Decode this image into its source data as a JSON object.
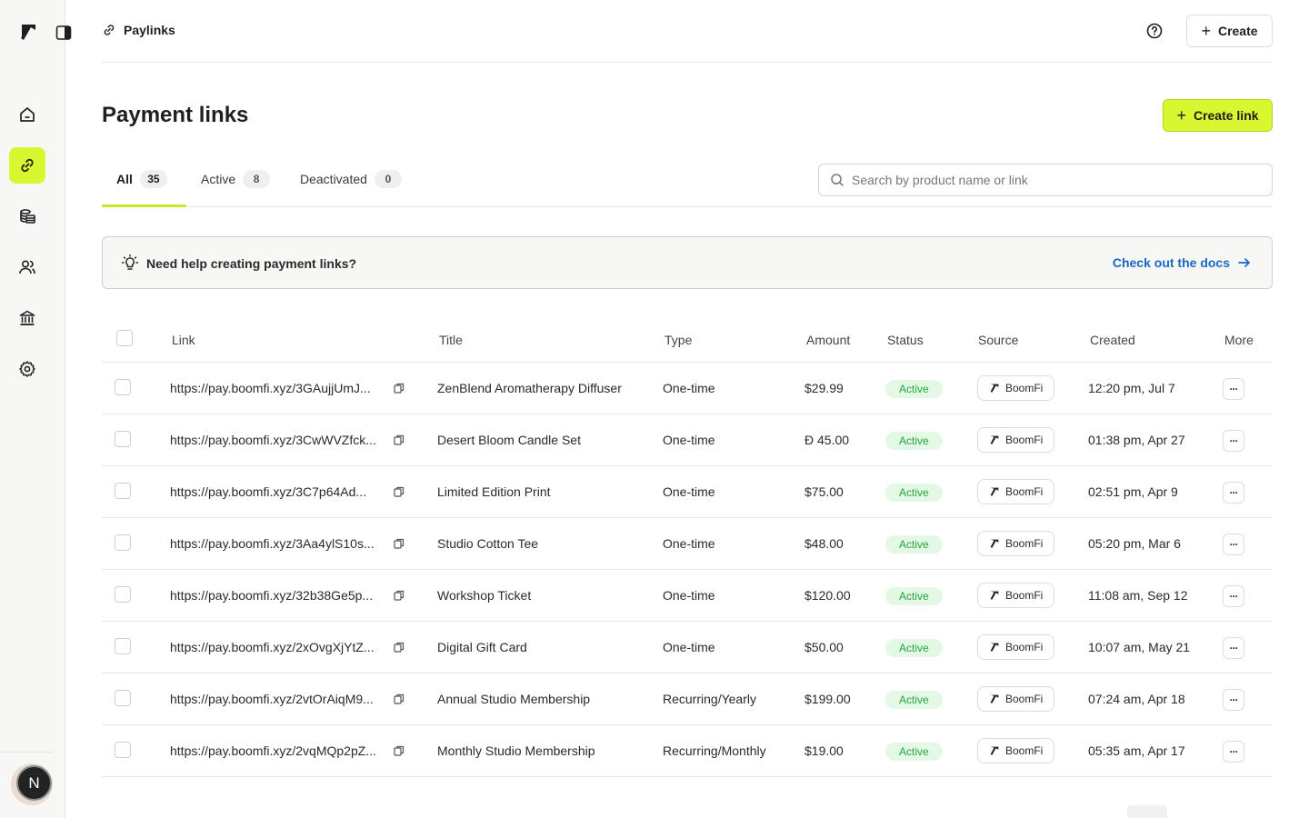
{
  "header": {
    "breadcrumb": "Paylinks",
    "create_label": "Create"
  },
  "sidebar": {
    "avatar_initial": "N",
    "items": [
      {
        "name": "home",
        "icon": "home-icon"
      },
      {
        "name": "paylinks",
        "icon": "link-icon",
        "active": true
      },
      {
        "name": "payments",
        "icon": "coins-icon"
      },
      {
        "name": "customers",
        "icon": "users-icon"
      },
      {
        "name": "banking",
        "icon": "bank-icon"
      },
      {
        "name": "settings",
        "icon": "gear-icon"
      }
    ]
  },
  "page": {
    "title": "Payment links",
    "create_link_label": "Create link"
  },
  "tabs": [
    {
      "label": "All",
      "count": "35",
      "active": true
    },
    {
      "label": "Active",
      "count": "8"
    },
    {
      "label": "Deactivated",
      "count": "0"
    }
  ],
  "search": {
    "placeholder": "Search by product name or link",
    "value": ""
  },
  "banner": {
    "text": "Need help creating payment links?",
    "link": "Check out the docs"
  },
  "table": {
    "columns": [
      "Link",
      "Title",
      "Type",
      "Amount",
      "Status",
      "Source",
      "Created",
      "More"
    ],
    "rows": [
      {
        "link": "https://pay.boomfi.xyz/3GAujjUmJ...",
        "title": "ZenBlend Aromatherapy Diffuser",
        "type": "One-time",
        "amount": "$29.99",
        "status": "Active",
        "source": "BoomFi",
        "created": "12:20 pm, Jul 7"
      },
      {
        "link": "https://pay.boomfi.xyz/3CwWVZfck...",
        "title": "Desert Bloom Candle Set",
        "type": "One-time",
        "amount": "Đ 45.00",
        "status": "Active",
        "source": "BoomFi",
        "created": "01:38 pm, Apr 27"
      },
      {
        "link": "https://pay.boomfi.xyz/3C7p64Ad...",
        "title": "Limited Edition Print",
        "type": "One-time",
        "amount": "$75.00",
        "status": "Active",
        "source": "BoomFi",
        "created": "02:51 pm, Apr 9"
      },
      {
        "link": "https://pay.boomfi.xyz/3Aa4ylS10s...",
        "title": "Studio Cotton Tee",
        "type": "One-time",
        "amount": "$48.00",
        "status": "Active",
        "source": "BoomFi",
        "created": "05:20 pm, Mar 6"
      },
      {
        "link": "https://pay.boomfi.xyz/32b38Ge5p...",
        "title": "Workshop Ticket",
        "type": "One-time",
        "amount": "$120.00",
        "status": "Active",
        "source": "BoomFi",
        "created": "11:08 am, Sep 12"
      },
      {
        "link": "https://pay.boomfi.xyz/2xOvgXjYtZ...",
        "title": "Digital Gift Card",
        "type": "One-time",
        "amount": "$50.00",
        "status": "Active",
        "source": "BoomFi",
        "created": "10:07 am, May 21"
      },
      {
        "link": "https://pay.boomfi.xyz/2vtOrAiqM9...",
        "title": "Annual Studio Membership",
        "type": "Recurring/Yearly",
        "amount": "$199.00",
        "status": "Active",
        "source": "BoomFi",
        "created": "07:24 am, Apr 18"
      },
      {
        "link": "https://pay.boomfi.xyz/2vqMQp2pZ...",
        "title": "Monthly Studio Membership",
        "type": "Recurring/Monthly",
        "amount": "$19.00",
        "status": "Active",
        "source": "BoomFi",
        "created": "05:35 am, Apr 17"
      }
    ]
  },
  "colors": {
    "accent": "#d8f731",
    "link": "#1769c4",
    "status_active_bg": "#e3f8e5",
    "status_active_text": "#23a63c"
  }
}
